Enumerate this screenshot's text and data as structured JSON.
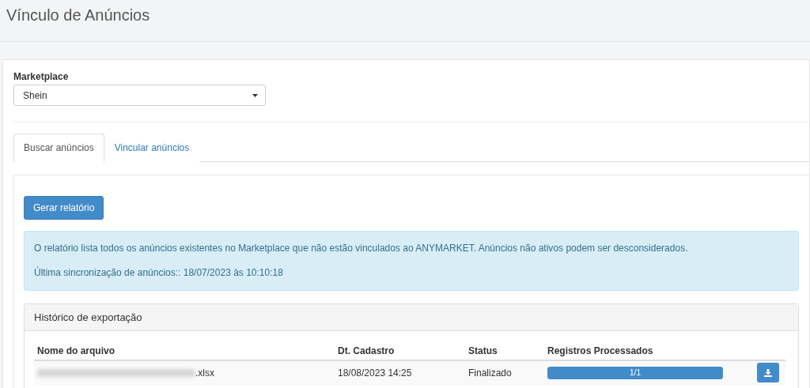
{
  "page_title": "Vínculo de Anúncios",
  "marketplace": {
    "label": "Marketplace",
    "value": "Shein"
  },
  "tabs": [
    {
      "label": "Buscar anúncios",
      "selected": true
    },
    {
      "label": "Vincular anúncios",
      "selected": false
    }
  ],
  "generate_button": "Gerar relatório",
  "info_alert": {
    "message": "O relatório lista todos os anúncios existentes no Marketplace que não estão vinculados ao ANYMARKET. Anúncios não ativos podem ser desconsiderados.",
    "last_sync": "Última sincronização de anúncios:: 18/07/2023 às 10:10:18"
  },
  "export_history": {
    "title": "Histórico de exportação",
    "columns": [
      "Nome do arquivo",
      "Dt. Cadastro",
      "Status",
      "Registros Processados"
    ],
    "rows": [
      {
        "file_name": ".xlsx",
        "file_name_blurred": true,
        "date": "18/08/2023 14:25",
        "status": "Finalizado",
        "progress_text": "1/1",
        "level": 1
      }
    ]
  }
}
